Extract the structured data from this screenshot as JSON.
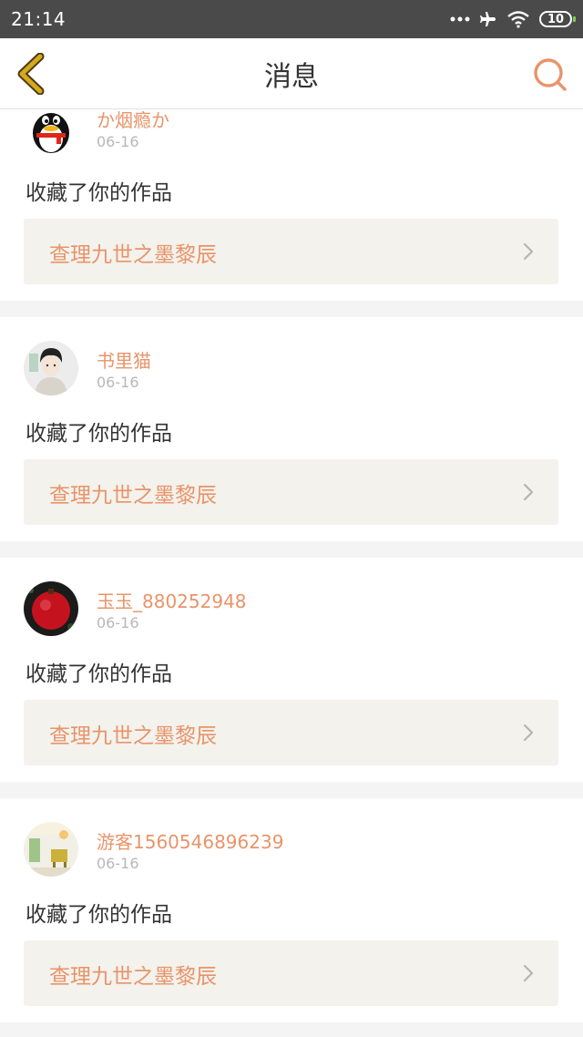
{
  "status_bar": {
    "time": "21:14",
    "battery": "10"
  },
  "nav": {
    "title": "消息",
    "accent": "#e8946a",
    "back_color": "#d6a81e"
  },
  "messages": [
    {
      "user": "か烟瘾か",
      "date": "06-16",
      "action": "收藏了你的作品",
      "work": "查理九世之墨黎辰",
      "avatar": "penguin-avatar"
    },
    {
      "user": "书里猫",
      "date": "06-16",
      "action": "收藏了你的作品",
      "work": "查理九世之墨黎辰",
      "avatar": "boy-avatar"
    },
    {
      "user": "玉玉_880252948",
      "date": "06-16",
      "action": "收藏了你的作品",
      "work": "查理九世之墨黎辰",
      "avatar": "pomegranate-avatar"
    },
    {
      "user": "游客1560546896239",
      "date": "06-16",
      "action": "收藏了你的作品",
      "work": "查理九世之墨黎辰",
      "avatar": "room-avatar"
    }
  ]
}
